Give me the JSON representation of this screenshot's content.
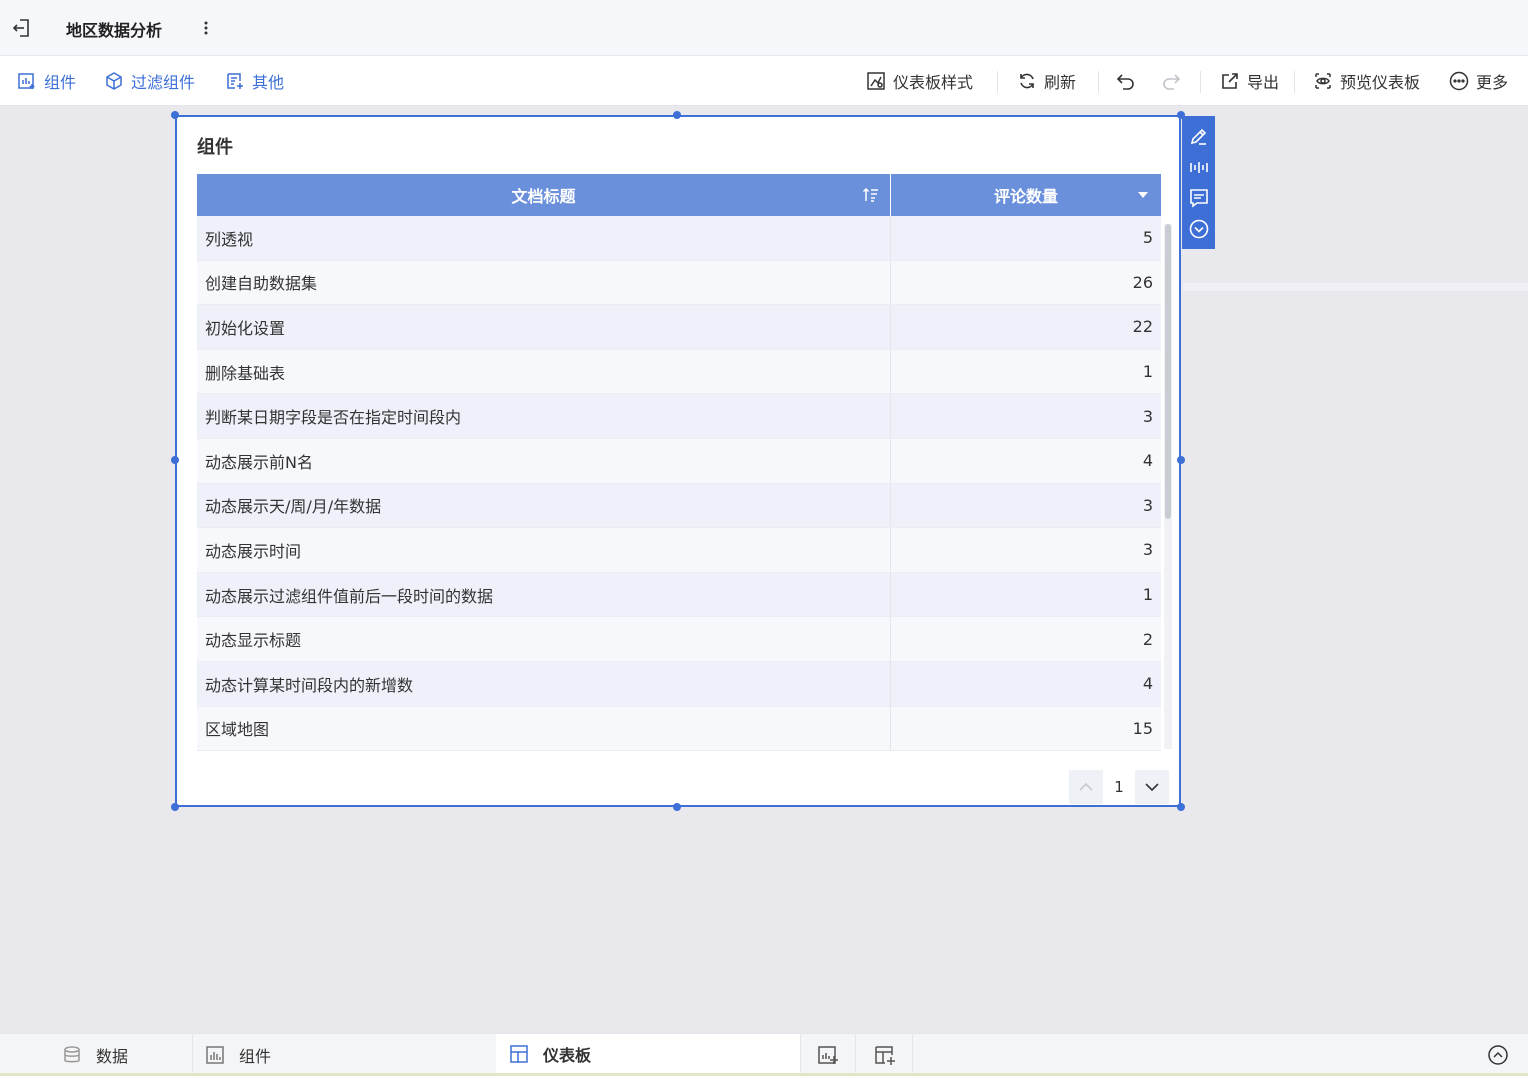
{
  "window": {
    "title": "地区数据分析"
  },
  "toolbar": {
    "components": "组件",
    "filter_components": "过滤组件",
    "other": "其他",
    "dashboard_style": "仪表板样式",
    "refresh": "刷新",
    "export": "导出",
    "preview_dashboard": "预览仪表板",
    "more": "更多"
  },
  "widget": {
    "title": "组件",
    "table": {
      "columns": [
        "文档标题",
        "评论数量"
      ],
      "rows": [
        {
          "title": "列透视",
          "count": "5"
        },
        {
          "title": "创建自助数据集",
          "count": "26"
        },
        {
          "title": "初始化设置",
          "count": "22"
        },
        {
          "title": "删除基础表",
          "count": "1"
        },
        {
          "title": "判断某日期字段是否在指定时间段内",
          "count": "3"
        },
        {
          "title": "动态展示前N名",
          "count": "4"
        },
        {
          "title": "动态展示天/周/月/年数据",
          "count": "3"
        },
        {
          "title": "动态展示时间",
          "count": "3"
        },
        {
          "title": "动态展示过滤组件值前后一段时间的数据",
          "count": "1"
        },
        {
          "title": "动态显示标题",
          "count": "2"
        },
        {
          "title": "动态计算某时间段内的新增数",
          "count": "4"
        },
        {
          "title": "区域地图",
          "count": "15"
        }
      ]
    },
    "pager": {
      "current_page": "1"
    }
  },
  "bottom_tabs": {
    "data": "数据",
    "components": "组件",
    "dashboard": "仪表板"
  },
  "colors": {
    "accent": "#3d6fd6",
    "header_bg": "#6a8fdb"
  }
}
